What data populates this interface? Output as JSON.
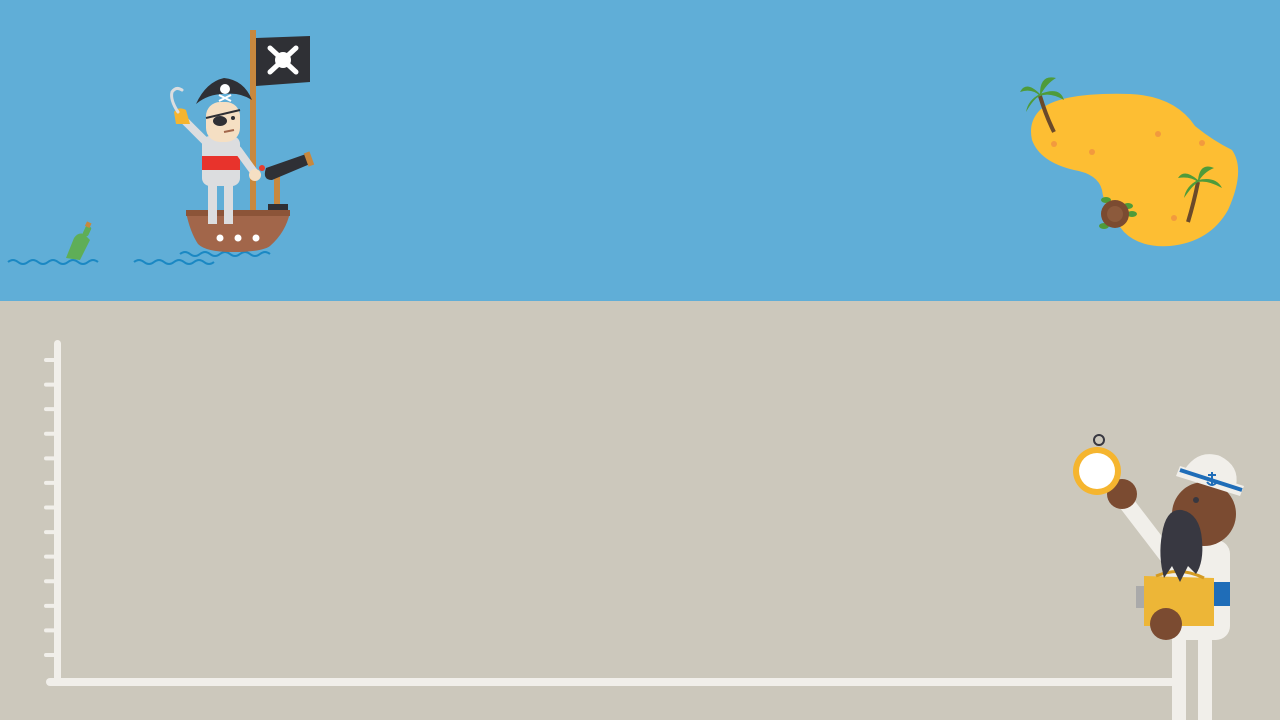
{
  "colors": {
    "sky": "#60aed7",
    "ground": "#ccc8bc",
    "axis": "#f1efea",
    "island": "#fdbe33",
    "palm_leaf": "#4e9b3a",
    "palm_trunk": "#6b4a2a",
    "ship_hull": "#a2664a",
    "flag": "#2f3035",
    "bottle": "#5fae57",
    "wave": "#1b88c3",
    "pirate_sash": "#e8332c",
    "pirate_body": "#dcdddf",
    "sailor_skin": "#7b4b31",
    "sailor_beard": "#383841",
    "sailor_stripe": "#1f6db8",
    "compass_ring": "#f5b52f",
    "compass_needle": "#e53d2f",
    "treasure": "#edb637"
  },
  "icons": [
    "pirate-character",
    "pirate-ship",
    "jolly-roger-flag-icon",
    "cannon-icon",
    "message-bottle-icon",
    "treasure-island",
    "palm-tree-icon",
    "turtle-icon",
    "sailor-character",
    "compass-icon",
    "treasure-map-icon"
  ],
  "graph": {
    "y_tick_count": 13
  }
}
